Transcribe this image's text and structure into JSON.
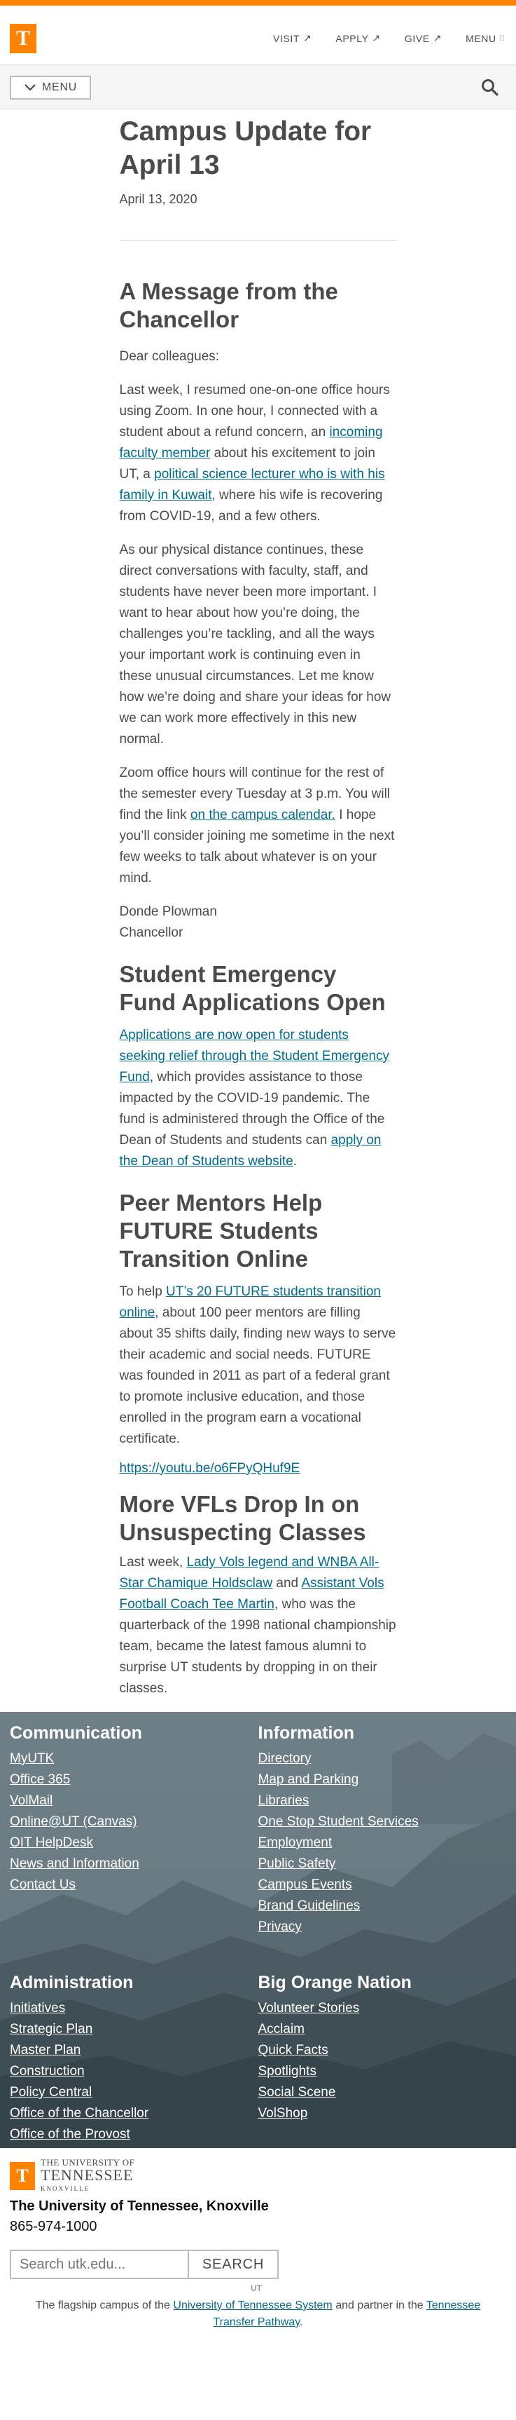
{
  "header": {
    "logo_letter": "T",
    "nav": [
      {
        "label": "VISIT",
        "icon": "external-arrow-icon"
      },
      {
        "label": "APPLY",
        "icon": "external-arrow-icon"
      },
      {
        "label": "GIVE",
        "icon": "external-arrow-icon"
      },
      {
        "label": "MENU",
        "icon": "grid-menu-icon"
      }
    ]
  },
  "subbar": {
    "menu_label": "MENU",
    "search_icon": "search-icon"
  },
  "article": {
    "title": "Campus Update for April 13",
    "date": "April 13, 2020"
  },
  "chancellor": {
    "heading": "A Message from the Chancellor",
    "p1": "Dear colleagues:",
    "p2_a": "Last week, I resumed one-on-one office hours using Zoom. In one hour, I connected with a student about a refund concern, an ",
    "p2_link1": "incoming faculty member",
    "p2_b": " about his excitement to join UT, a ",
    "p2_link2": "political science lecturer who is with his family in Kuwait",
    "p2_c": ", where his wife is recovering from COVID-19, and a few others.",
    "p3": "As our physical distance continues, these direct conversations with faculty, staff, and students have never been more important. I want to hear about how you’re doing, the challenges you’re tackling, and all the ways your important work is continuing even in these unusual circumstances. Let me know how we’re doing and share your ideas for how we can work more effectively in this new normal.",
    "p4_a": "Zoom office hours will continue for the rest of the semester every Tuesday at 3 p.m. You will find the link ",
    "p4_link": "on the campus calendar.",
    "p4_b": " I hope you’ll consider joining me sometime in the next few weeks to talk about whatever is on your mind.",
    "sig_name": "Donde Plowman",
    "sig_title": "Chancellor"
  },
  "emergency": {
    "heading": "Student Emergency Fund Applications Open",
    "link1": "Applications are now open for students seeking relief through the Student Emergency Fund",
    "text_a": ", which provides assistance to those impacted by the COVID-19 pandemic. The fund is administered through the Office of the Dean of Students and students can ",
    "link2": "apply on the Dean of Students website",
    "text_b": "."
  },
  "mentors": {
    "heading": "Peer Mentors Help FUTURE Students Transition Online",
    "text_a": "To help ",
    "link1": "UT’s 20 FUTURE students transition online",
    "text_b": ", about 100 peer mentors are filling about 35 shifts daily, finding new ways to serve their academic and social needs. FUTURE was founded in 2011 as part of a federal grant to promote inclusive education, and those enrolled in the program earn a vocational certificate.",
    "youtube": "https://youtu.be/o6FPyQHuf9E"
  },
  "vfls": {
    "heading": "More VFLs Drop In on Unsuspecting Classes",
    "text_a": "Last week, ",
    "link1": "Lady Vols legend and WNBA All-Star Chamique Holdsclaw",
    "text_b": " and ",
    "link2": "Assistant Vols Football Coach Tee Martin",
    "text_c": ", who was the quarterback of the 1998 national championship team, became the latest famous alumni to surprise UT students by dropping in on their classes."
  },
  "footer": {
    "communication": {
      "heading": "Communication",
      "links": [
        "MyUTK",
        "Office 365",
        "VolMail",
        "Online@UT (Canvas)",
        "OIT HelpDesk",
        "News and Information",
        "Contact Us"
      ]
    },
    "information": {
      "heading": "Information",
      "links": [
        "Directory",
        "Map and Parking",
        "Libraries",
        "One Stop Student Services",
        "Employment",
        "Public Safety",
        "Campus Events",
        "Brand Guidelines",
        "Privacy"
      ]
    },
    "administration": {
      "heading": "Administration",
      "links": [
        "Initiatives",
        "Strategic Plan",
        "Master Plan",
        "Construction",
        "Policy Central",
        "Office of the Chancellor",
        "Office of the Provost"
      ]
    },
    "big_orange": {
      "heading": "Big Orange Nation",
      "links": [
        "Volunteer Stories",
        "Acclaim",
        "Quick Facts",
        "Spotlights",
        "Social Scene",
        "VolShop"
      ]
    }
  },
  "bottom": {
    "logo_top": "THE UNIVERSITY OF",
    "logo_main": "TENNESSEE",
    "logo_sub": "KNOXVILLE",
    "name": "The University of Tennessee, Knoxville",
    "phone": "865-974-1000",
    "search_placeholder": "Search utk.edu...",
    "search_button": "SEARCH",
    "tiny_mark": "UT",
    "flagship_a": "The flagship campus of the ",
    "flagship_link1": "University of Tennessee System",
    "flagship_b": " and partner in the ",
    "flagship_link2": "Tennessee Transfer Pathway",
    "flagship_c": "."
  },
  "colors": {
    "orange": "#ff8200",
    "link": "#006c93",
    "text": "#4b4b4b"
  }
}
